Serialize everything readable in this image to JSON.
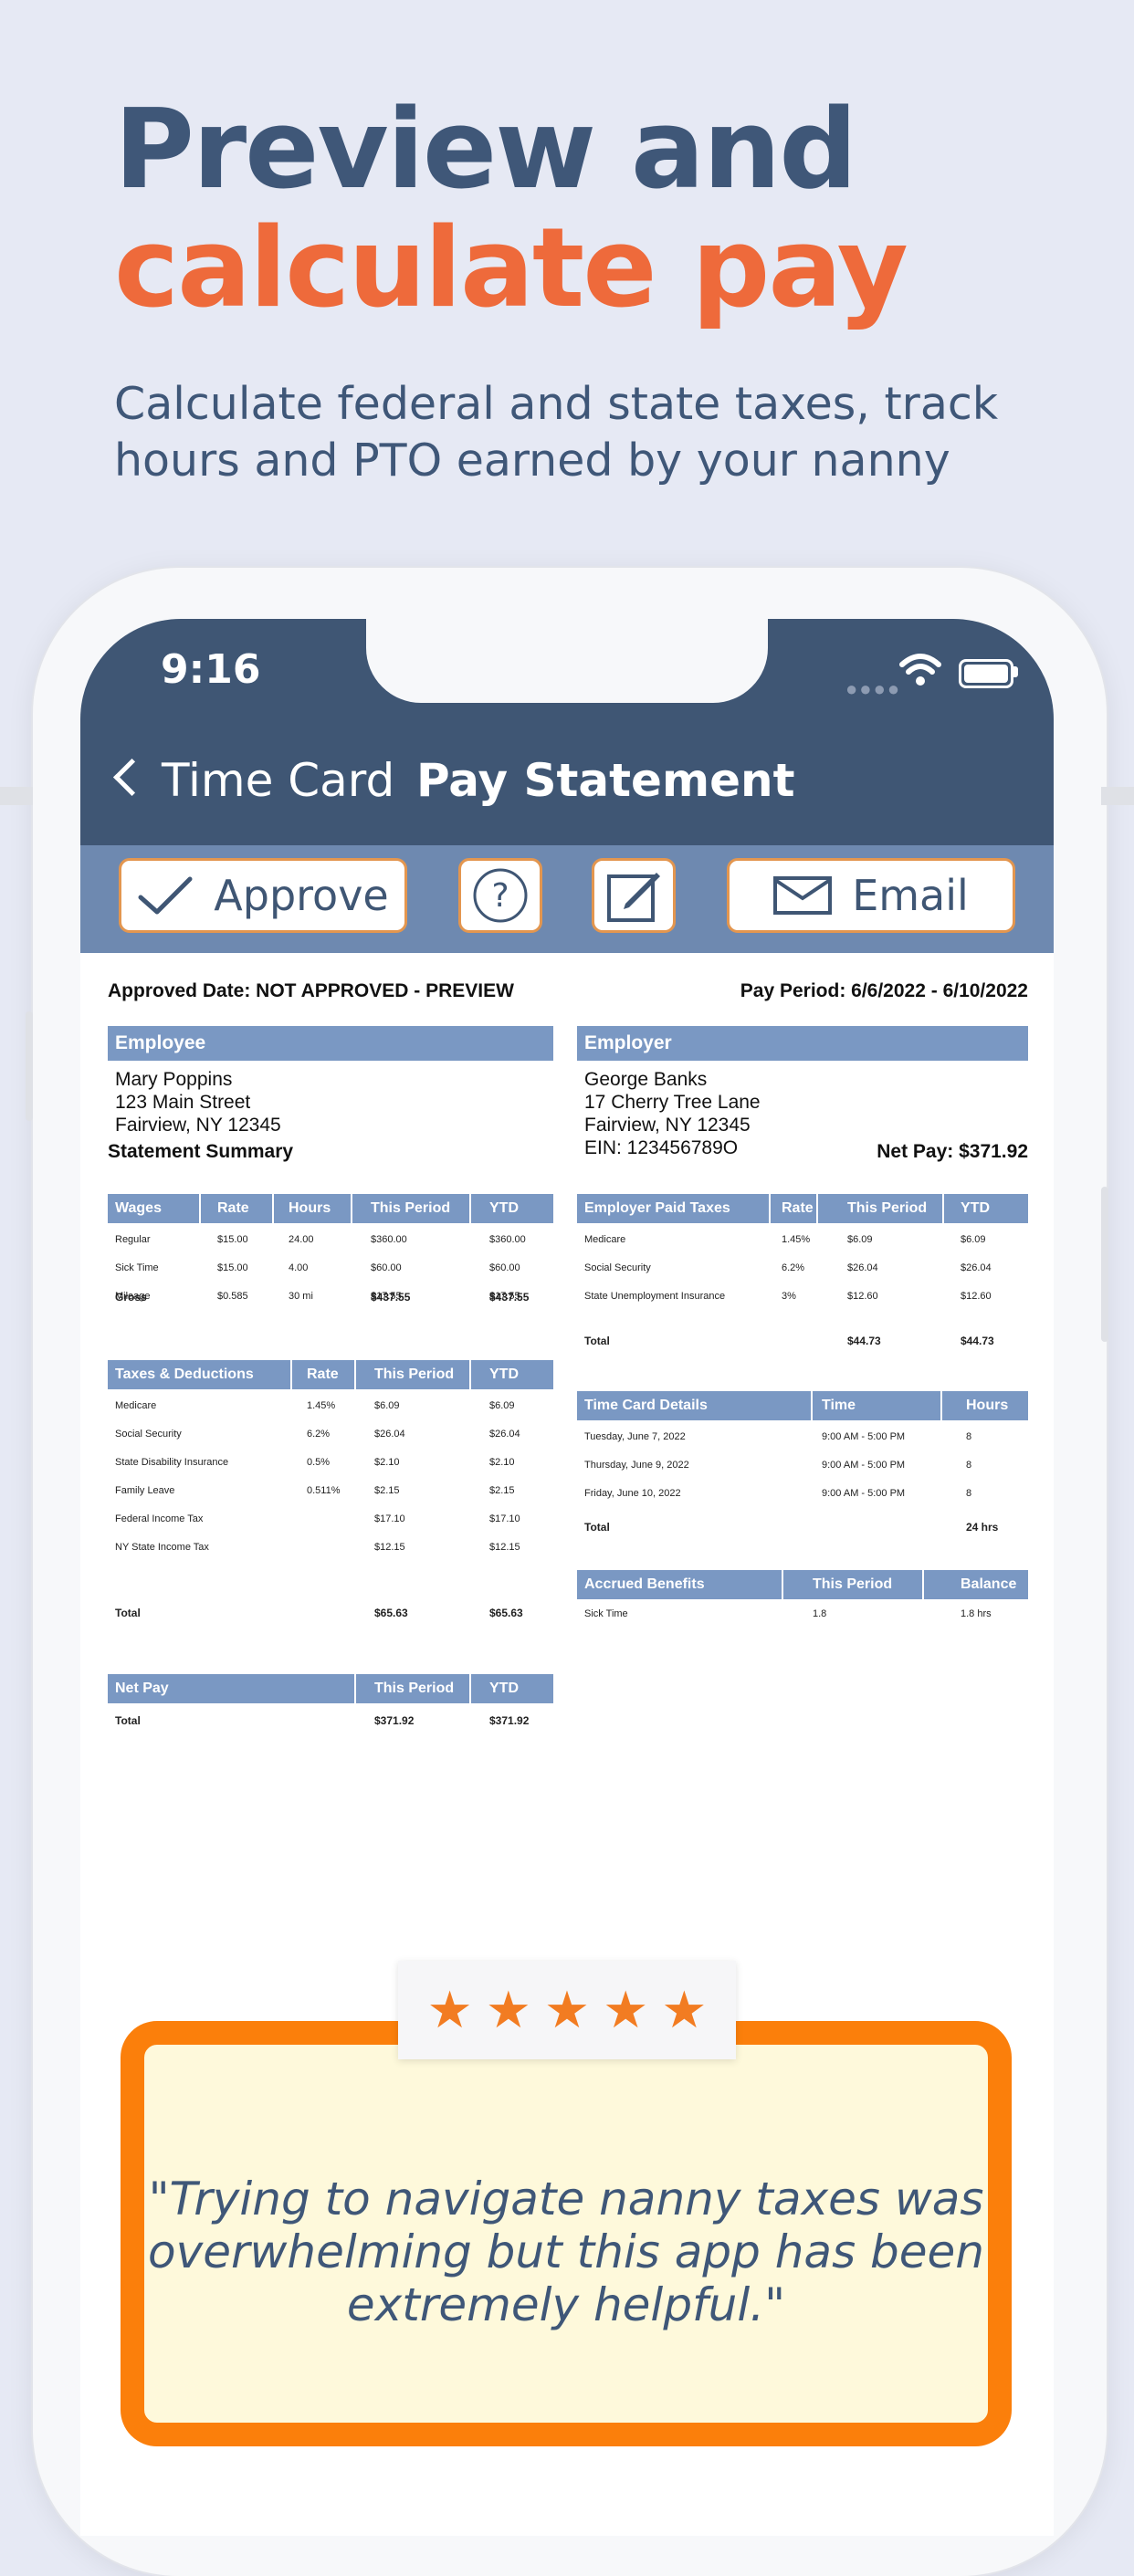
{
  "hero": {
    "line1": "Preview and",
    "line2": "calculate pay",
    "subtitle": "Calculate federal and state taxes, track hours and PTO earned by your nanny"
  },
  "status": {
    "time": "9:16"
  },
  "nav": {
    "back_label": "Time Card",
    "title": "Pay Statement"
  },
  "toolbar": {
    "approve_label": "Approve",
    "email_label": "Email",
    "accent": "#e3964f"
  },
  "statement": {
    "approved_date": "Approved Date: NOT APPROVED - PREVIEW",
    "pay_period": "Pay Period: 6/6/2022 - 6/10/2022",
    "employee": {
      "heading": "Employee",
      "name": "Mary Poppins",
      "street": "123 Main Street",
      "city": "Fairview, NY 12345"
    },
    "employer": {
      "heading": "Employer",
      "name": "George Banks",
      "street": "17 Cherry Tree Lane",
      "city": "Fairview, NY 12345",
      "ein": "EIN: 123456789O"
    },
    "summary_label": "Statement Summary",
    "net_pay_label": "Net Pay: $371.92",
    "wages": {
      "headers": [
        "Wages",
        "Rate",
        "Hours",
        "This Period",
        "YTD"
      ],
      "rows": [
        [
          "Regular",
          "$15.00",
          "24.00",
          "$360.00",
          "$360.00"
        ],
        [
          "Sick Time",
          "$15.00",
          "4.00",
          "$60.00",
          "$60.00"
        ],
        [
          "Mileage",
          "$0.585",
          "30 mi",
          "$17.55",
          "$17.55"
        ]
      ],
      "total": [
        "Gross",
        "",
        "",
        "$437.55",
        "$437.55"
      ]
    },
    "taxes": {
      "headers": [
        "Taxes & Deductions",
        "Rate",
        "This Period",
        "YTD"
      ],
      "rows": [
        [
          "Medicare",
          "1.45%",
          "$6.09",
          "$6.09"
        ],
        [
          "Social Security",
          "6.2%",
          "$26.04",
          "$26.04"
        ],
        [
          "State Disability Insurance",
          "0.5%",
          "$2.10",
          "$2.10"
        ],
        [
          "Family Leave",
          "0.511%",
          "$2.15",
          "$2.15"
        ],
        [
          "Federal Income Tax",
          "",
          "$17.10",
          "$17.10"
        ],
        [
          "NY State Income Tax",
          "",
          "$12.15",
          "$12.15"
        ]
      ],
      "total": [
        "Total",
        "",
        "$65.63",
        "$65.63"
      ]
    },
    "net_pay": {
      "headers": [
        "Net Pay",
        "This Period",
        "YTD"
      ],
      "total": [
        "Total",
        "$371.92",
        "$371.92"
      ]
    },
    "employer_taxes": {
      "headers": [
        "Employer Paid Taxes",
        "Rate",
        "This Period",
        "YTD"
      ],
      "rows": [
        [
          "Medicare",
          "1.45%",
          "$6.09",
          "$6.09"
        ],
        [
          "Social Security",
          "6.2%",
          "$26.04",
          "$26.04"
        ],
        [
          "State Unemployment Insurance",
          "3%",
          "$12.60",
          "$12.60"
        ]
      ],
      "total": [
        "Total",
        "",
        "$44.73",
        "$44.73"
      ]
    },
    "time_card": {
      "headers": [
        "Time Card Details",
        "Time",
        "Hours"
      ],
      "rows": [
        [
          "Tuesday, June 7, 2022",
          "9:00 AM - 5:00 PM",
          "8"
        ],
        [
          "Thursday, June 9, 2022",
          "9:00 AM - 5:00 PM",
          "8"
        ],
        [
          "Friday, June 10, 2022",
          "9:00 AM - 5:00 PM",
          "8"
        ]
      ],
      "total": [
        "Total",
        "",
        "24 hrs"
      ]
    },
    "accrued": {
      "headers": [
        "Accrued Benefits",
        "This Period",
        "Balance"
      ],
      "rows": [
        [
          "Sick Time",
          "1.8",
          "1.8 hrs"
        ]
      ]
    }
  },
  "review": {
    "rating": 5,
    "quote": "\"Trying to navigate nanny taxes was overwhelming but this app has been extremely helpful.\""
  }
}
